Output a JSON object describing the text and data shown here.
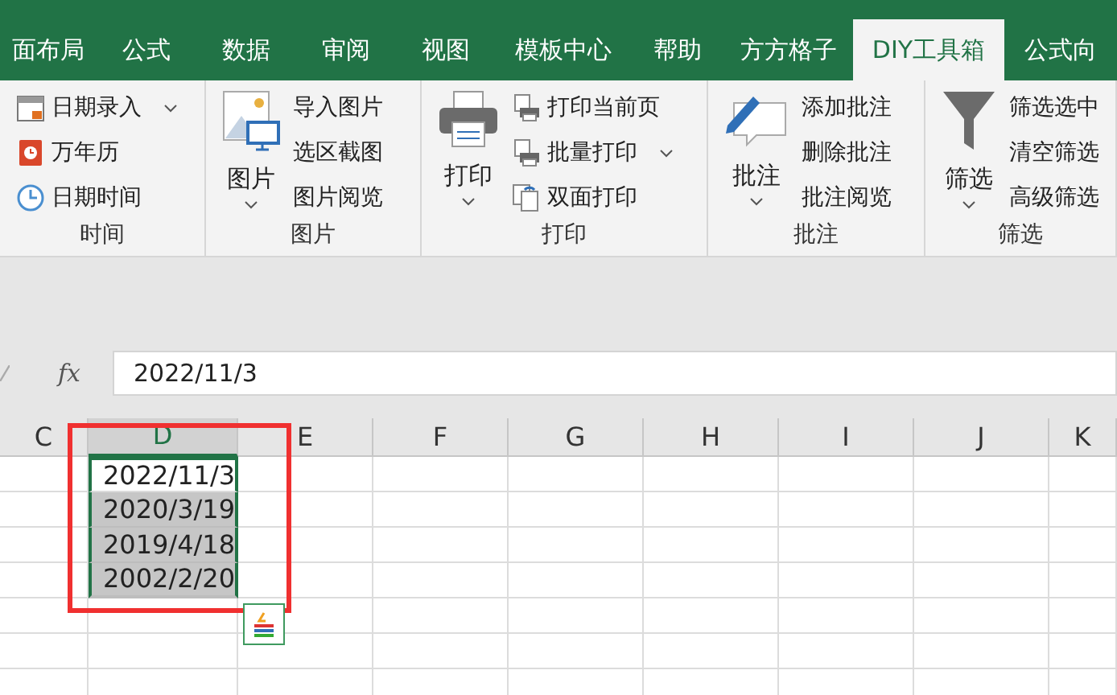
{
  "tabs": [
    {
      "label": "面布局",
      "selected": false
    },
    {
      "label": "公式",
      "selected": false
    },
    {
      "label": "数据",
      "selected": false
    },
    {
      "label": "审阅",
      "selected": false
    },
    {
      "label": "视图",
      "selected": false
    },
    {
      "label": "模板中心",
      "selected": false
    },
    {
      "label": "帮助",
      "selected": false
    },
    {
      "label": "方方格子",
      "selected": false
    },
    {
      "label": "DIY工具箱",
      "selected": true
    },
    {
      "label": "公式向",
      "selected": false
    }
  ],
  "ribbon_groups": [
    {
      "label": "时间",
      "items": [
        {
          "label": "日期录入",
          "dropdown": true
        },
        {
          "label": "万年历",
          "dropdown": false
        },
        {
          "label": "日期时间",
          "dropdown": false
        }
      ]
    },
    {
      "label": "图片",
      "large": {
        "label": "图片",
        "dropdown": true
      },
      "items": [
        {
          "label": "导入图片",
          "dropdown": false
        },
        {
          "label": "选区截图",
          "dropdown": false
        },
        {
          "label": "图片阅览",
          "dropdown": false
        }
      ]
    },
    {
      "label": "打印",
      "large": {
        "label": "打印",
        "dropdown": true
      },
      "items": [
        {
          "label": "打印当前页",
          "dropdown": false
        },
        {
          "label": "批量打印",
          "dropdown": true
        },
        {
          "label": "双面打印",
          "dropdown": false
        }
      ]
    },
    {
      "label": "批注",
      "large": {
        "label": "批注",
        "dropdown": true
      },
      "items": [
        {
          "label": "添加批注",
          "dropdown": false
        },
        {
          "label": "删除批注",
          "dropdown": false
        },
        {
          "label": "批注阅览",
          "dropdown": false
        }
      ]
    },
    {
      "label": "筛选",
      "large": {
        "label": "筛选",
        "dropdown": true
      },
      "items": [
        {
          "label": "筛选选中",
          "dropdown": false
        },
        {
          "label": "清空筛选",
          "dropdown": false
        },
        {
          "label": "高级筛选",
          "dropdown": false
        }
      ]
    }
  ],
  "formula_bar": {
    "fx": "fx",
    "value": "2022/11/3"
  },
  "columns": [
    {
      "label": "C",
      "selected": false
    },
    {
      "label": "D",
      "selected": true
    },
    {
      "label": "E",
      "selected": false
    },
    {
      "label": "F",
      "selected": false
    },
    {
      "label": "G",
      "selected": false
    },
    {
      "label": "H",
      "selected": false
    },
    {
      "label": "I",
      "selected": false
    },
    {
      "label": "J",
      "selected": false
    },
    {
      "label": "K",
      "selected": false
    }
  ],
  "column_d_cells": [
    {
      "value": "2022/11/3",
      "selected": false
    },
    {
      "value": "2020/3/19",
      "selected": true
    },
    {
      "value": "2019/4/18",
      "selected": true
    },
    {
      "value": "2002/2/20",
      "selected": true
    }
  ]
}
